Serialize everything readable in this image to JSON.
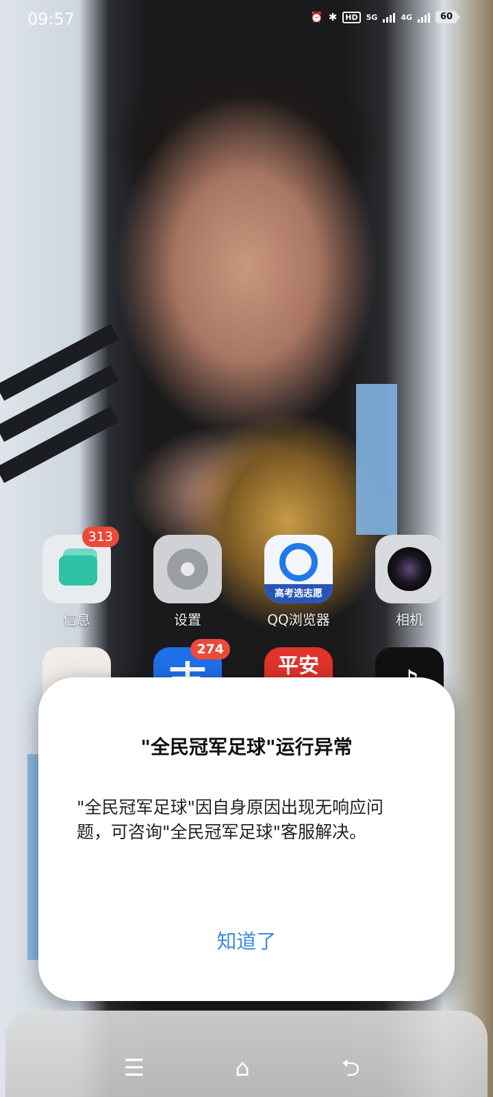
{
  "status_bar": {
    "time": "09:57",
    "hd_label": "HD",
    "net1": "5G",
    "net2": "4G",
    "battery": "60"
  },
  "apps": [
    {
      "label": "信息",
      "badge": "313",
      "icon": "messages-icon"
    },
    {
      "label": "设置",
      "badge": "",
      "icon": "settings-gear-icon"
    },
    {
      "label": "QQ浏览器",
      "badge": "",
      "icon": "qq-browser-icon",
      "icon_text": "高考选志愿"
    },
    {
      "label": "相机",
      "badge": "",
      "icon": "camera-icon"
    },
    {
      "label": "",
      "badge": "",
      "icon": "clock-icon"
    },
    {
      "label": "",
      "badge": "274",
      "icon": "alipay-icon",
      "icon_text": "支"
    },
    {
      "label": "",
      "badge": "",
      "icon": "pingan-icon",
      "icon_text": "平安"
    },
    {
      "label": "",
      "badge": "",
      "icon": "tiktok-icon",
      "icon_text": "♪"
    }
  ],
  "dialog": {
    "title": "\"全民冠军足球\"运行异常",
    "body": "\"全民冠军足球\"因自身原因出现无响应问题，可咨询\"全民冠军足球\"客服解决。",
    "button": "知道了"
  },
  "nav": {
    "menu_icon": "☰",
    "home_icon": "⌂",
    "back_icon": "⮌"
  },
  "colors": {
    "accent": "#3d8bdb",
    "badge": "#e94a3a"
  }
}
